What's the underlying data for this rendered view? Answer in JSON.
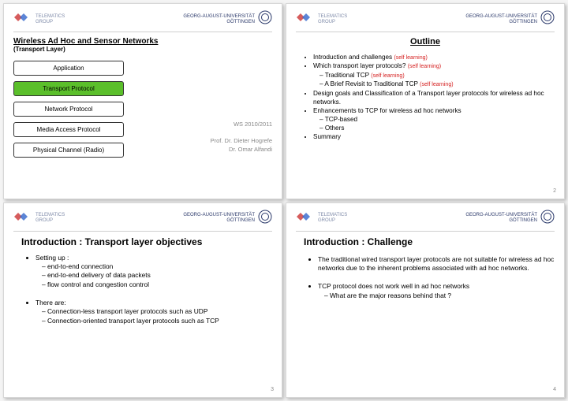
{
  "brand": {
    "group": "TELEMATICS\nGROUP",
    "uni": "GEORG-AUGUST-UNIVERSITÄT\nGÖTTINGEN"
  },
  "slide1": {
    "title": "Wireless Ad Hoc and Sensor Networks",
    "subtitle": "(Transport Layer)",
    "layers": [
      "Application",
      "Transport Protocol",
      "Network Protocol",
      "Media Access Protocol",
      "Physical Channel (Radio)"
    ],
    "semester": "WS 2010/2011",
    "prof": "Prof. Dr. Dieter Hogrefe",
    "asst": "Dr. Omar Alfandi"
  },
  "slide2": {
    "title": "Outline",
    "i1": "Introduction and challenges",
    "i1_note": "(self learning)",
    "i2": "Which transport layer protocols?",
    "i2_note": "(self learning)",
    "i2a": "Traditional TCP",
    "i2a_note": "(self learning)",
    "i2b": "A Brief Revisit to Traditional TCP",
    "i2b_note": "(self learning)",
    "i3": "Design goals and Classification of a Transport layer protocols for wireless ad hoc networks.",
    "i4": "Enhancements to TCP for wireless ad hoc networks",
    "i4a": "TCP-based",
    "i4b": "Others",
    "i5": "Summary",
    "page": "2"
  },
  "slide3": {
    "title": "Introduction : Transport layer objectives",
    "a": "Setting up :",
    "a1": "end-to-end connection",
    "a2": "end-to-end delivery of data packets",
    "a3": "flow control and congestion control",
    "b": "There are:",
    "b1": "Connection-less transport layer protocols  such as UDP",
    "b2": "Connection-oriented transport layer protocols such as TCP",
    "page": "3"
  },
  "slide4": {
    "title": "Introduction : Challenge",
    "a": "The traditional wired transport layer protocols are not suitable for wireless ad hoc networks due to the inherent problems associated with ad hoc networks.",
    "b": "TCP protocol does not work well in ad hoc networks",
    "b1": "What are the major reasons behind that ?",
    "page": "4"
  }
}
